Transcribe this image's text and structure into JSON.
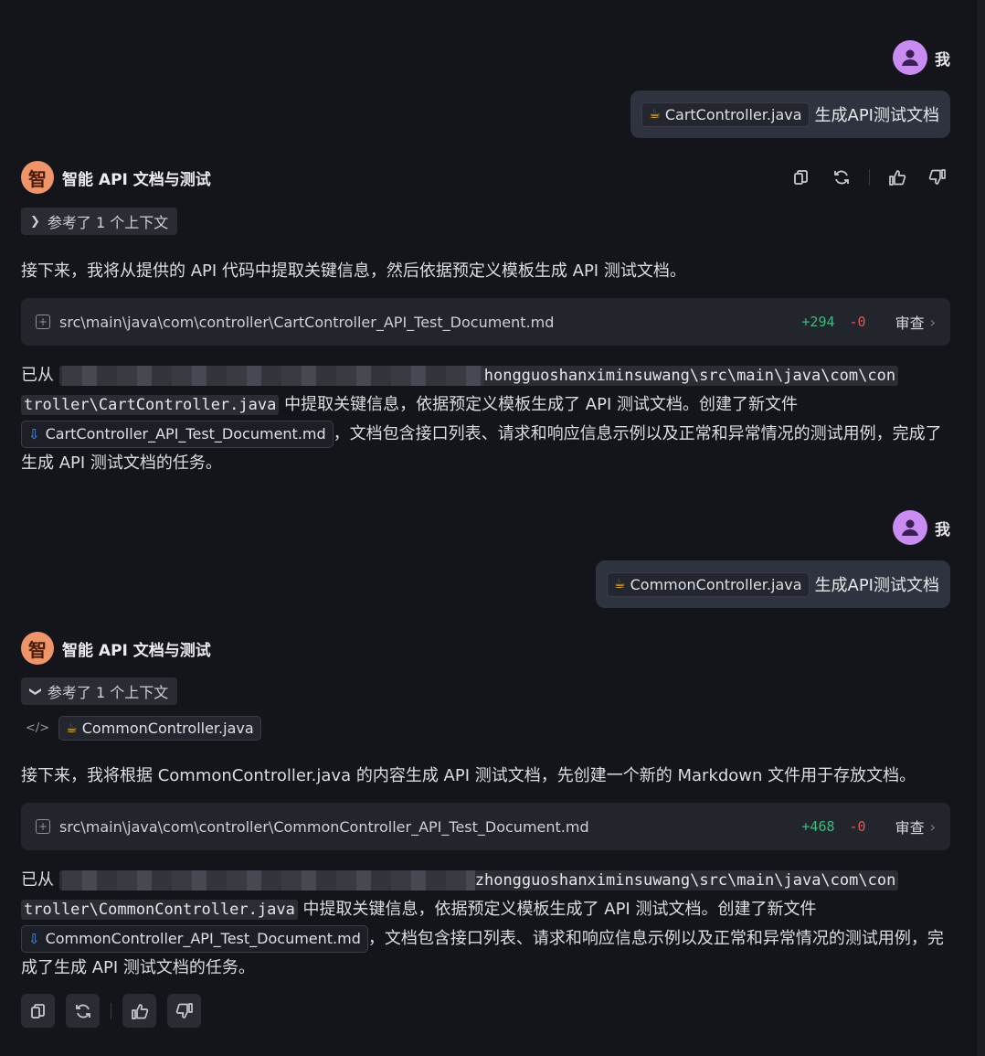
{
  "conversation": [
    {
      "user": {
        "name": "我",
        "file": "CartController.java",
        "prompt": "生成API测试文档"
      },
      "assistant": {
        "name": "智能 API 文档与测试",
        "avatar_char": "智",
        "context_label": "参考了 1 个上下文",
        "context_file": "",
        "intro": "接下来，我将从提供的 API 代码中提取关键信息，然后依据预定义模板生成 API 测试文档。",
        "file_change": {
          "path": "src\\main\\java\\com\\controller\\CartController_API_Test_Document.md",
          "added": "+294",
          "removed": "-0",
          "review": "审查"
        },
        "summary": {
          "prefix": "已从",
          "path_visible": "hongguoshanximinsuwang\\src\\main\\java\\com\\con",
          "path_line2": "troller\\CartController.java",
          "mid": "中提取关键信息，依据预定义模板生成了 API 测试文档。创建了新文件",
          "new_file": "CartController_API_Test_Document.md",
          "suffix": "，文档包含接口列表、请求和响应信息示例以及正常和异常情况的测试用例，完成了生成 API 测试文档的任务。"
        }
      }
    },
    {
      "user": {
        "name": "我",
        "file": "CommonController.java",
        "prompt": "生成API测试文档"
      },
      "assistant": {
        "name": "智能 API 文档与测试",
        "avatar_char": "智",
        "context_label": "参考了 1 个上下文",
        "context_file": "CommonController.java",
        "intro": "接下来，我将根据 CommonController.java 的内容生成 API 测试文档，先创建一个新的 Markdown 文件用于存放文档。",
        "file_change": {
          "path": "src\\main\\java\\com\\controller\\CommonController_API_Test_Document.md",
          "added": "+468",
          "removed": "-0",
          "review": "审查"
        },
        "summary": {
          "prefix": "已从",
          "path_visible": "zhongguoshanximinsuwang\\src\\main\\java\\com\\con",
          "path_line2": "troller\\CommonController.java",
          "mid": "中提取关键信息，依据预定义模板生成了 API 测试文档。创建了新文件",
          "new_file": "CommonController_API_Test_Document.md",
          "suffix": "，文档包含接口列表、请求和响应信息示例以及正常和异常情况的测试用例，完成了生成 API 测试文档的任务。"
        }
      }
    }
  ],
  "icons": {
    "copy": "copy-icon",
    "regenerate": "refresh-icon",
    "like": "thumbs-up-icon",
    "dislike": "thumbs-down-icon",
    "java": "java-cup-icon",
    "download": "download-icon",
    "add_file": "plus-square-icon",
    "chevron_right": "chevron-right-icon",
    "chevron_down": "chevron-down-icon",
    "code": "code-icon"
  },
  "colors": {
    "background": "#14151a",
    "user_avatar": "#c98cf0",
    "ai_avatar": "#f0956a",
    "diff_added": "#3fb97c",
    "diff_removed": "#e05757",
    "link_icon": "#4a8ff0"
  }
}
